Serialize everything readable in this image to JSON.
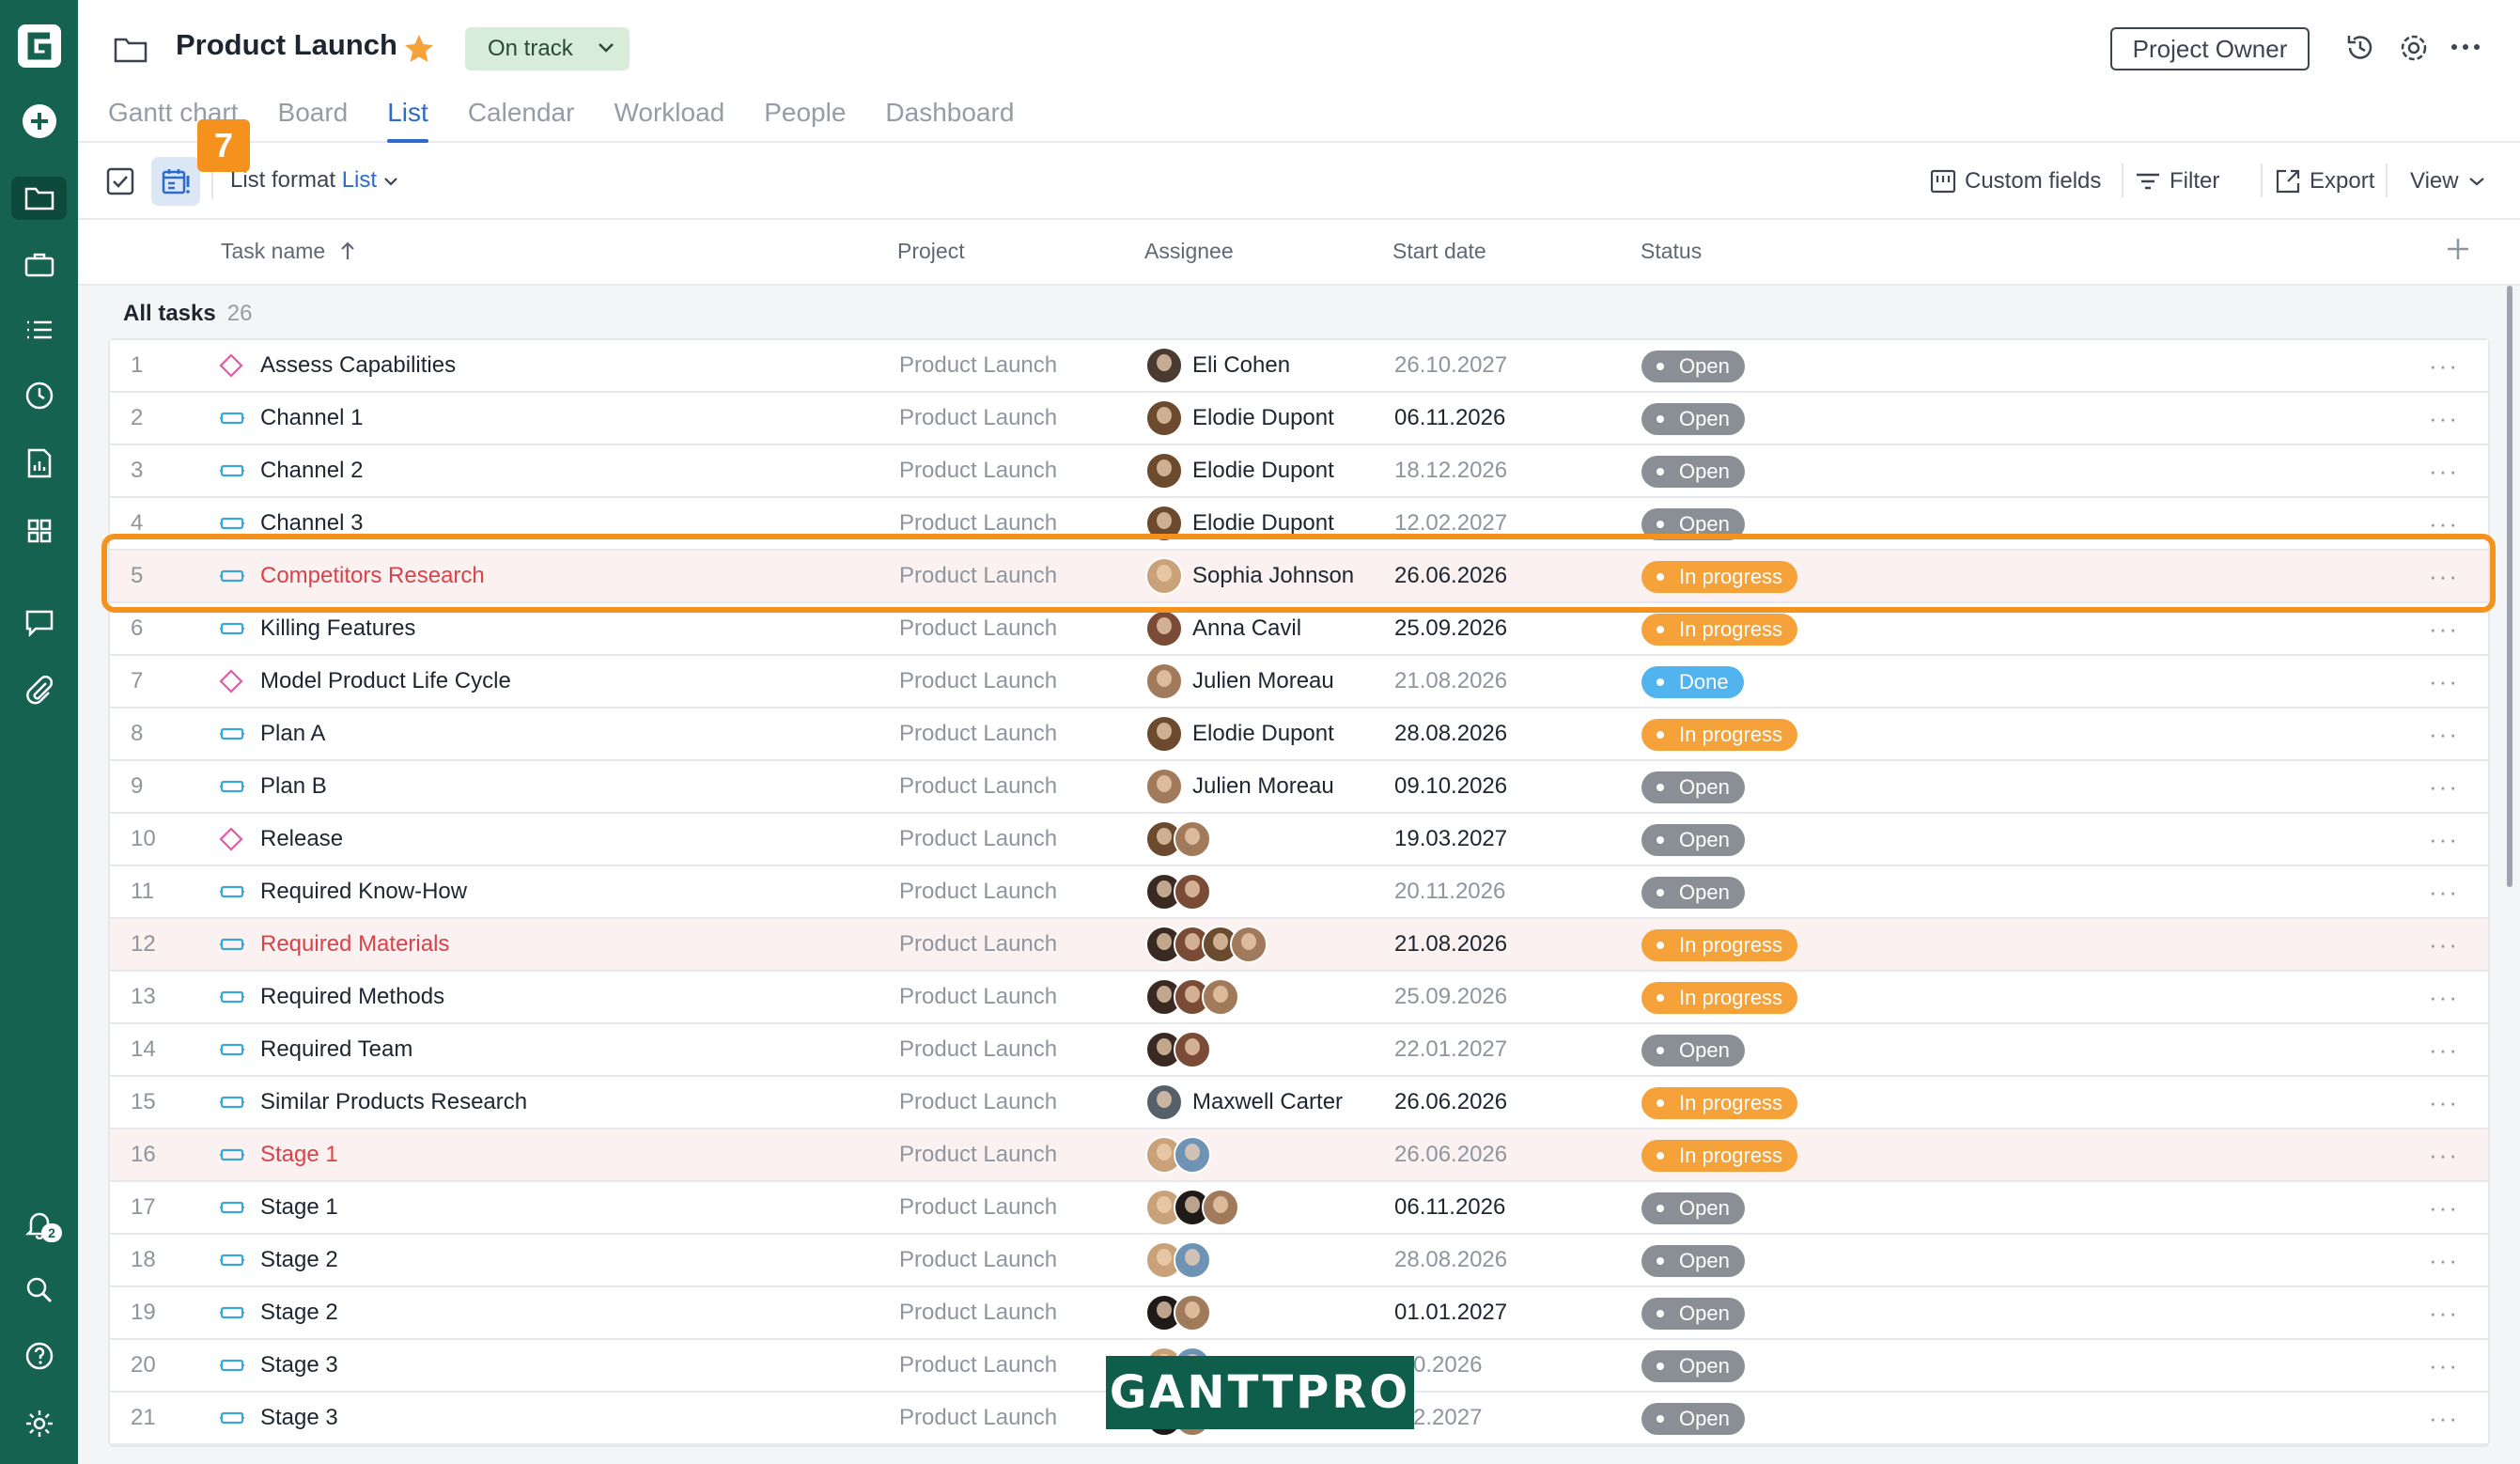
{
  "app": {
    "project_title": "Product Launch",
    "status_label": "On track",
    "owner_label": "Project Owner",
    "notification_count": "2",
    "accent_color": "#2d6bc9",
    "brand_color": "#14624f"
  },
  "tabs": [
    {
      "label": "Gantt chart"
    },
    {
      "label": "Board"
    },
    {
      "label": "List"
    },
    {
      "label": "Calendar"
    },
    {
      "label": "Workload"
    },
    {
      "label": "People"
    },
    {
      "label": "Dashboard"
    }
  ],
  "toolbar": {
    "step_badge": "7",
    "list_format_label": "List format",
    "list_format_value": "List",
    "custom_fields": "Custom fields",
    "filter": "Filter",
    "export": "Export",
    "view": "View"
  },
  "columns": {
    "task_name": "Task name",
    "project": "Project",
    "assignee": "Assignee",
    "start_date": "Start date",
    "status": "Status"
  },
  "group": {
    "title": "All tasks",
    "count": "26"
  },
  "statuses": {
    "Open": "#8a8f96",
    "In progress": "#f5a23a",
    "Done": "#52b4ee"
  },
  "tasks": [
    {
      "num": "1",
      "name": "Assess Capabilities",
      "type": "milestone",
      "project": "Product Launch",
      "assignee": "Eli Cohen",
      "avatars": [
        "#4a3a30"
      ],
      "date": "26.10.2027",
      "date_dark": false,
      "status": "Open",
      "highlight": false
    },
    {
      "num": "2",
      "name": "Channel 1",
      "type": "task",
      "project": "Product Launch",
      "assignee": "Elodie Dupont",
      "avatars": [
        "#6b4a2e"
      ],
      "date": "06.11.2026",
      "date_dark": true,
      "status": "Open",
      "highlight": false
    },
    {
      "num": "3",
      "name": "Channel 2",
      "type": "task",
      "project": "Product Launch",
      "assignee": "Elodie Dupont",
      "avatars": [
        "#6b4a2e"
      ],
      "date": "18.12.2026",
      "date_dark": false,
      "status": "Open",
      "highlight": false
    },
    {
      "num": "4",
      "name": "Channel 3",
      "type": "task",
      "project": "Product Launch",
      "assignee": "Elodie Dupont",
      "avatars": [
        "#6b4a2e"
      ],
      "date": "12.02.2027",
      "date_dark": false,
      "status": "Open",
      "highlight": false
    },
    {
      "num": "5",
      "name": "Competitors Research",
      "type": "task",
      "project": "Product Launch",
      "assignee": "Sophia Johnson",
      "avatars": [
        "#c9a27a"
      ],
      "date": "26.06.2026",
      "date_dark": true,
      "status": "In progress",
      "highlight": true
    },
    {
      "num": "6",
      "name": "Killing Features",
      "type": "task",
      "project": "Product Launch",
      "assignee": "Anna Cavil",
      "avatars": [
        "#7a4b36"
      ],
      "date": "25.09.2026",
      "date_dark": true,
      "status": "In progress",
      "highlight": false
    },
    {
      "num": "7",
      "name": "Model Product Life Cycle",
      "type": "milestone",
      "project": "Product Launch",
      "assignee": "Julien Moreau",
      "avatars": [
        "#a07a5a"
      ],
      "date": "21.08.2026",
      "date_dark": false,
      "status": "Done",
      "highlight": false
    },
    {
      "num": "8",
      "name": "Plan A",
      "type": "task",
      "project": "Product Launch",
      "assignee": "Elodie Dupont",
      "avatars": [
        "#6b4a2e"
      ],
      "date": "28.08.2026",
      "date_dark": true,
      "status": "In progress",
      "highlight": false
    },
    {
      "num": "9",
      "name": "Plan B",
      "type": "task",
      "project": "Product Launch",
      "assignee": "Julien Moreau",
      "avatars": [
        "#a07a5a"
      ],
      "date": "09.10.2026",
      "date_dark": true,
      "status": "Open",
      "highlight": false
    },
    {
      "num": "10",
      "name": "Release",
      "type": "milestone",
      "project": "Product Launch",
      "assignee": "",
      "avatars": [
        "#6b4a2e",
        "#a07a5a"
      ],
      "date": "19.03.2027",
      "date_dark": true,
      "status": "Open",
      "highlight": false
    },
    {
      "num": "11",
      "name": "Required Know-How",
      "type": "task",
      "project": "Product Launch",
      "assignee": "",
      "avatars": [
        "#3a2a22",
        "#7a4b36"
      ],
      "date": "20.11.2026",
      "date_dark": false,
      "status": "Open",
      "highlight": false
    },
    {
      "num": "12",
      "name": "Required Materials",
      "type": "task",
      "project": "Product Launch",
      "assignee": "",
      "avatars": [
        "#3a2a22",
        "#7a4b36",
        "#6b4a2e",
        "#a07a5a"
      ],
      "date": "21.08.2026",
      "date_dark": true,
      "status": "In progress",
      "highlight": true
    },
    {
      "num": "13",
      "name": "Required Methods",
      "type": "task",
      "project": "Product Launch",
      "assignee": "",
      "avatars": [
        "#3a2a22",
        "#7a4b36",
        "#a07a5a"
      ],
      "date": "25.09.2026",
      "date_dark": false,
      "status": "In progress",
      "highlight": false
    },
    {
      "num": "14",
      "name": "Required Team",
      "type": "task",
      "project": "Product Launch",
      "assignee": "",
      "avatars": [
        "#3a2a22",
        "#7a4b36"
      ],
      "date": "22.01.2027",
      "date_dark": false,
      "status": "Open",
      "highlight": false
    },
    {
      "num": "15",
      "name": "Similar Products Research",
      "type": "task",
      "project": "Product Launch",
      "assignee": "Maxwell Carter",
      "avatars": [
        "#55606a"
      ],
      "date": "26.06.2026",
      "date_dark": true,
      "status": "In progress",
      "highlight": false
    },
    {
      "num": "16",
      "name": "Stage 1",
      "type": "task",
      "project": "Product Launch",
      "assignee": "",
      "avatars": [
        "#c9a27a",
        "#6f93b4"
      ],
      "date": "26.06.2026",
      "date_dark": false,
      "status": "In progress",
      "highlight": true
    },
    {
      "num": "17",
      "name": "Stage 1",
      "type": "task",
      "project": "Product Launch",
      "assignee": "",
      "avatars": [
        "#c9a27a",
        "#1f1a18",
        "#a07a5a"
      ],
      "date": "06.11.2026",
      "date_dark": true,
      "status": "Open",
      "highlight": false
    },
    {
      "num": "18",
      "name": "Stage 2",
      "type": "task",
      "project": "Product Launch",
      "assignee": "",
      "avatars": [
        "#c9a27a",
        "#6f93b4"
      ],
      "date": "28.08.2026",
      "date_dark": false,
      "status": "Open",
      "highlight": false
    },
    {
      "num": "19",
      "name": "Stage 2",
      "type": "task",
      "project": "Product Launch",
      "assignee": "",
      "avatars": [
        "#1f1a18",
        "#a07a5a"
      ],
      "date": "01.01.2027",
      "date_dark": true,
      "status": "Open",
      "highlight": false
    },
    {
      "num": "20",
      "name": "Stage 3",
      "type": "task",
      "project": "Product Launch",
      "assignee": "",
      "avatars": [
        "#c9a27a",
        "#6f93b4"
      ],
      "date": ".10.2026",
      "date_dark": false,
      "status": "Open",
      "highlight": false
    },
    {
      "num": "21",
      "name": "Stage 3",
      "type": "task",
      "project": "Product Launch",
      "assignee": "",
      "avatars": [
        "#1f1a18",
        "#a07a5a"
      ],
      "date": ".02.2027",
      "date_dark": false,
      "status": "Open",
      "highlight": false
    }
  ],
  "watermark": "GANTTPRO"
}
